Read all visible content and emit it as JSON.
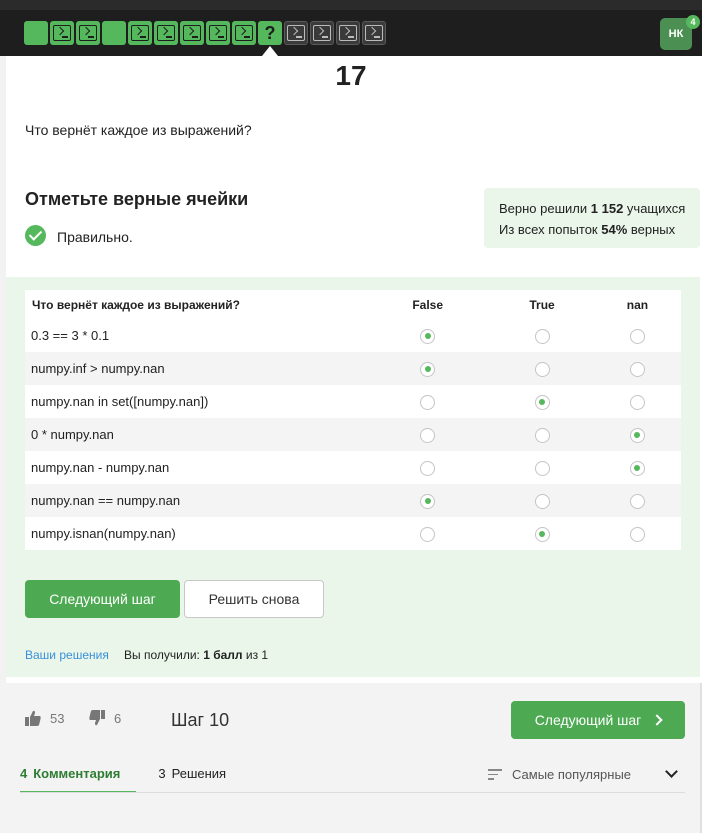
{
  "steps": [
    {
      "kind": "solid"
    },
    {
      "kind": "code-green"
    },
    {
      "kind": "code-green"
    },
    {
      "kind": "solid"
    },
    {
      "kind": "code-green"
    },
    {
      "kind": "code-green"
    },
    {
      "kind": "code-green"
    },
    {
      "kind": "code-green"
    },
    {
      "kind": "code-green"
    },
    {
      "kind": "quiz",
      "label": "?"
    },
    {
      "kind": "code-dark"
    },
    {
      "kind": "code-dark"
    },
    {
      "kind": "code-dark"
    },
    {
      "kind": "code-dark"
    }
  ],
  "user": {
    "initials": "НК",
    "notifications": "4"
  },
  "step_number": "17",
  "question": "Что вернёт каждое из выражений?",
  "feedback": {
    "title": "Отметьте верные ячейки",
    "status": "Правильно."
  },
  "stats": {
    "line1_prefix": "Верно решили ",
    "line1_value": "1 152",
    "line1_suffix": " учащихся",
    "line2_prefix": "Из всех попыток ",
    "line2_value": "54%",
    "line2_suffix": " верных"
  },
  "table": {
    "header": "Что вернёт каждое из выражений?",
    "columns": [
      "False",
      "True",
      "nan"
    ],
    "rows": [
      {
        "expr": "0.3 == 3 * 0.1",
        "selected": 0
      },
      {
        "expr": "numpy.inf > numpy.nan",
        "selected": 0
      },
      {
        "expr": "numpy.nan in set([numpy.nan])",
        "selected": 1
      },
      {
        "expr": "0 * numpy.nan",
        "selected": 2
      },
      {
        "expr": "numpy.nan - numpy.nan",
        "selected": 2
      },
      {
        "expr": "numpy.nan == numpy.nan",
        "selected": 0
      },
      {
        "expr": "numpy.isnan(numpy.nan)",
        "selected": 1
      }
    ]
  },
  "buttons": {
    "next": "Следующий шаг",
    "retry": "Решить снова"
  },
  "result": {
    "your_solutions": "Ваши решения",
    "got_prefix": "Вы получили: ",
    "got_value": "1 балл",
    "got_suffix": " из 1"
  },
  "footer": {
    "likes": "53",
    "dislikes": "6",
    "step_label": "Шаг 10",
    "next": "Следующий шаг",
    "tabs": [
      {
        "count": "4",
        "label": "Комментария"
      },
      {
        "count": "3",
        "label": "Решения"
      }
    ],
    "sort": "Самые популярные"
  },
  "colors": {
    "accent": "#56b85c",
    "link": "#3b8fd9",
    "panel": "#e9f6e9"
  }
}
